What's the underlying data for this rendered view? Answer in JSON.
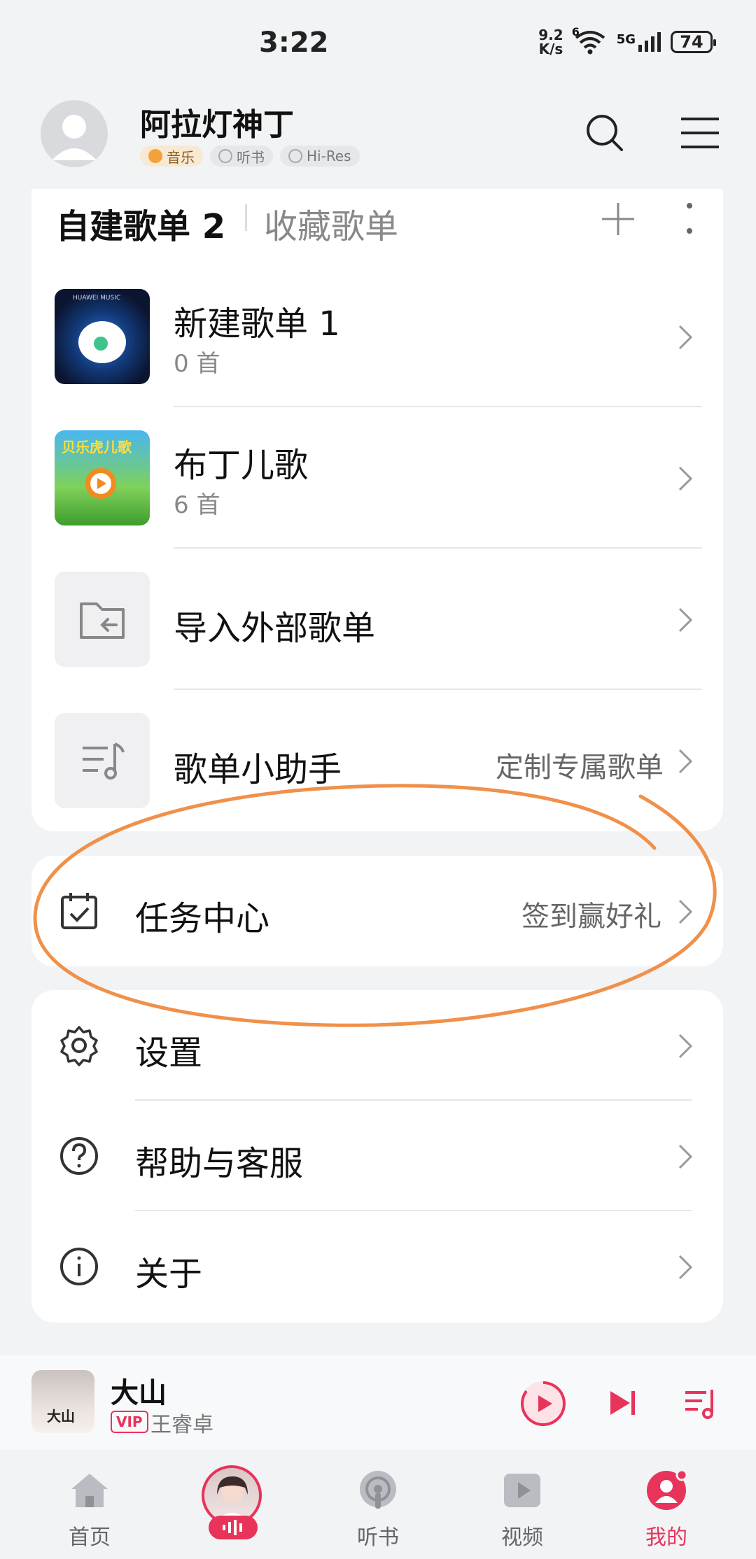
{
  "status_bar": {
    "time": "3:22",
    "net_speed_value": "9.2",
    "net_speed_unit": "K/s",
    "wifi_label": "6",
    "network_label": "5G",
    "battery": "74"
  },
  "header": {
    "username": "阿拉灯神丁",
    "badges": [
      "音乐",
      "听书",
      "Hi-Res"
    ]
  },
  "playlists": {
    "tab_active": "自建歌单 2",
    "tab_other": "收藏歌单",
    "items": [
      {
        "title": "新建歌单 1",
        "subtitle": "0 首",
        "thumb_text": "HUAWEI MUSIC"
      },
      {
        "title": "布丁儿歌",
        "subtitle": "6 首",
        "thumb_text": "贝乐虎儿歌"
      },
      {
        "title": "导入外部歌单",
        "subtitle": "",
        "extra": ""
      },
      {
        "title": "歌单小助手",
        "subtitle": "",
        "extra": "定制专属歌单"
      }
    ]
  },
  "task_center": {
    "label": "任务中心",
    "extra": "签到赢好礼"
  },
  "settings_menu": [
    {
      "label": "设置"
    },
    {
      "label": "帮助与客服"
    },
    {
      "label": "关于"
    }
  ],
  "player": {
    "title": "大山",
    "vip_label": "VIP",
    "artist": "王睿卓",
    "cover_text": "大山"
  },
  "nav": [
    {
      "label": "首页"
    },
    {
      "label": ""
    },
    {
      "label": "听书"
    },
    {
      "label": "视频"
    },
    {
      "label": "我的"
    }
  ],
  "colors": {
    "accent": "#e8335a",
    "annotation": "#f0904a"
  }
}
